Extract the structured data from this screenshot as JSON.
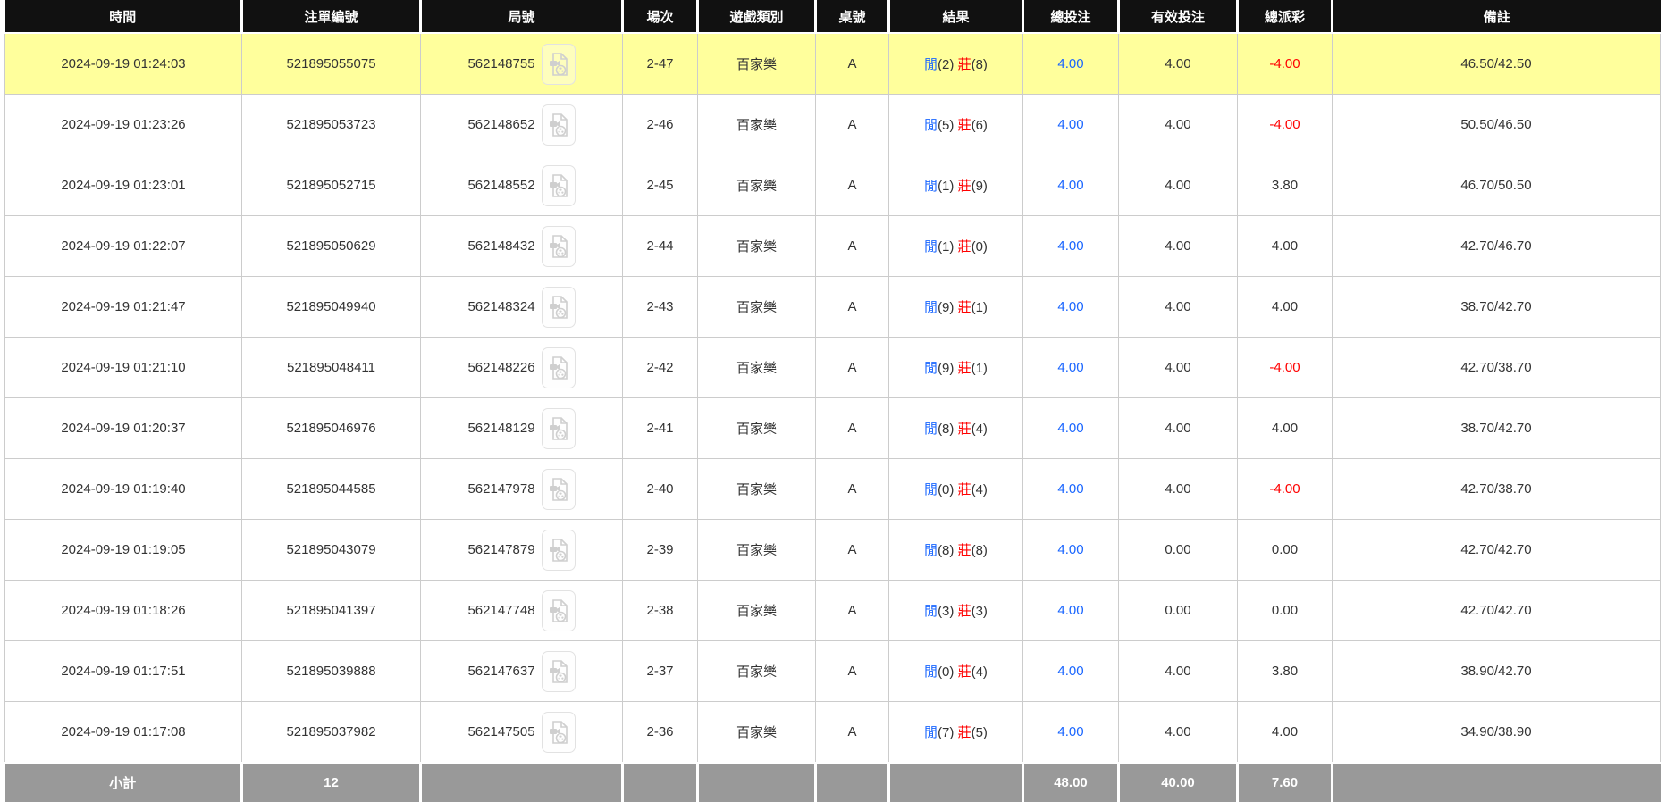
{
  "colors": {
    "header_bg": "#111111",
    "highlight_row": "#ffff9c",
    "footer_bg": "#999999",
    "accent_blue": "#1a66ff",
    "accent_red": "#ff0000",
    "border": "#cccccc"
  },
  "icons": {
    "video": "video-playback-icon"
  },
  "table": {
    "columns": [
      {
        "key": "time",
        "label": "時間"
      },
      {
        "key": "bet_id",
        "label": "注單編號"
      },
      {
        "key": "round_id",
        "label": "局號"
      },
      {
        "key": "session",
        "label": "場次"
      },
      {
        "key": "game_type",
        "label": "遊戲類別"
      },
      {
        "key": "table_no",
        "label": "桌號"
      },
      {
        "key": "result",
        "label": "結果"
      },
      {
        "key": "total_bet",
        "label": "總投注"
      },
      {
        "key": "valid_bet",
        "label": "有效投注"
      },
      {
        "key": "payout",
        "label": "總派彩"
      },
      {
        "key": "remark",
        "label": "備註"
      }
    ],
    "rows": [
      {
        "highlighted": true,
        "time": "2024-09-19 01:24:03",
        "bet_id": "521895055075",
        "round_id": "562148755",
        "session": "2-47",
        "game_type": "百家樂",
        "table_no": "A",
        "result": {
          "player": "閒",
          "player_score": "2",
          "banker": "莊",
          "banker_score": "8"
        },
        "total_bet": "4.00",
        "valid_bet": "4.00",
        "payout": "-4.00",
        "remark": "46.50/42.50"
      },
      {
        "highlighted": false,
        "time": "2024-09-19 01:23:26",
        "bet_id": "521895053723",
        "round_id": "562148652",
        "session": "2-46",
        "game_type": "百家樂",
        "table_no": "A",
        "result": {
          "player": "閒",
          "player_score": "5",
          "banker": "莊",
          "banker_score": "6"
        },
        "total_bet": "4.00",
        "valid_bet": "4.00",
        "payout": "-4.00",
        "remark": "50.50/46.50"
      },
      {
        "highlighted": false,
        "time": "2024-09-19 01:23:01",
        "bet_id": "521895052715",
        "round_id": "562148552",
        "session": "2-45",
        "game_type": "百家樂",
        "table_no": "A",
        "result": {
          "player": "閒",
          "player_score": "1",
          "banker": "莊",
          "banker_score": "9"
        },
        "total_bet": "4.00",
        "valid_bet": "4.00",
        "payout": "3.80",
        "remark": "46.70/50.50"
      },
      {
        "highlighted": false,
        "time": "2024-09-19 01:22:07",
        "bet_id": "521895050629",
        "round_id": "562148432",
        "session": "2-44",
        "game_type": "百家樂",
        "table_no": "A",
        "result": {
          "player": "閒",
          "player_score": "1",
          "banker": "莊",
          "banker_score": "0"
        },
        "total_bet": "4.00",
        "valid_bet": "4.00",
        "payout": "4.00",
        "remark": "42.70/46.70"
      },
      {
        "highlighted": false,
        "time": "2024-09-19 01:21:47",
        "bet_id": "521895049940",
        "round_id": "562148324",
        "session": "2-43",
        "game_type": "百家樂",
        "table_no": "A",
        "result": {
          "player": "閒",
          "player_score": "9",
          "banker": "莊",
          "banker_score": "1"
        },
        "total_bet": "4.00",
        "valid_bet": "4.00",
        "payout": "4.00",
        "remark": "38.70/42.70"
      },
      {
        "highlighted": false,
        "time": "2024-09-19 01:21:10",
        "bet_id": "521895048411",
        "round_id": "562148226",
        "session": "2-42",
        "game_type": "百家樂",
        "table_no": "A",
        "result": {
          "player": "閒",
          "player_score": "9",
          "banker": "莊",
          "banker_score": "1"
        },
        "total_bet": "4.00",
        "valid_bet": "4.00",
        "payout": "-4.00",
        "remark": "42.70/38.70"
      },
      {
        "highlighted": false,
        "time": "2024-09-19 01:20:37",
        "bet_id": "521895046976",
        "round_id": "562148129",
        "session": "2-41",
        "game_type": "百家樂",
        "table_no": "A",
        "result": {
          "player": "閒",
          "player_score": "8",
          "banker": "莊",
          "banker_score": "4"
        },
        "total_bet": "4.00",
        "valid_bet": "4.00",
        "payout": "4.00",
        "remark": "38.70/42.70"
      },
      {
        "highlighted": false,
        "time": "2024-09-19 01:19:40",
        "bet_id": "521895044585",
        "round_id": "562147978",
        "session": "2-40",
        "game_type": "百家樂",
        "table_no": "A",
        "result": {
          "player": "閒",
          "player_score": "0",
          "banker": "莊",
          "banker_score": "4"
        },
        "total_bet": "4.00",
        "valid_bet": "4.00",
        "payout": "-4.00",
        "remark": "42.70/38.70"
      },
      {
        "highlighted": false,
        "time": "2024-09-19 01:19:05",
        "bet_id": "521895043079",
        "round_id": "562147879",
        "session": "2-39",
        "game_type": "百家樂",
        "table_no": "A",
        "result": {
          "player": "閒",
          "player_score": "8",
          "banker": "莊",
          "banker_score": "8"
        },
        "total_bet": "4.00",
        "valid_bet": "0.00",
        "payout": "0.00",
        "remark": "42.70/42.70"
      },
      {
        "highlighted": false,
        "time": "2024-09-19 01:18:26",
        "bet_id": "521895041397",
        "round_id": "562147748",
        "session": "2-38",
        "game_type": "百家樂",
        "table_no": "A",
        "result": {
          "player": "閒",
          "player_score": "3",
          "banker": "莊",
          "banker_score": "3"
        },
        "total_bet": "4.00",
        "valid_bet": "0.00",
        "payout": "0.00",
        "remark": "42.70/42.70"
      },
      {
        "highlighted": false,
        "time": "2024-09-19 01:17:51",
        "bet_id": "521895039888",
        "round_id": "562147637",
        "session": "2-37",
        "game_type": "百家樂",
        "table_no": "A",
        "result": {
          "player": "閒",
          "player_score": "0",
          "banker": "莊",
          "banker_score": "4"
        },
        "total_bet": "4.00",
        "valid_bet": "4.00",
        "payout": "3.80",
        "remark": "38.90/42.70"
      },
      {
        "highlighted": false,
        "time": "2024-09-19 01:17:08",
        "bet_id": "521895037982",
        "round_id": "562147505",
        "session": "2-36",
        "game_type": "百家樂",
        "table_no": "A",
        "result": {
          "player": "閒",
          "player_score": "7",
          "banker": "莊",
          "banker_score": "5"
        },
        "total_bet": "4.00",
        "valid_bet": "4.00",
        "payout": "4.00",
        "remark": "34.90/38.90"
      }
    ],
    "footer": {
      "label": "小計",
      "count": "12",
      "total_bet": "48.00",
      "valid_bet": "40.00",
      "payout": "7.60"
    }
  }
}
